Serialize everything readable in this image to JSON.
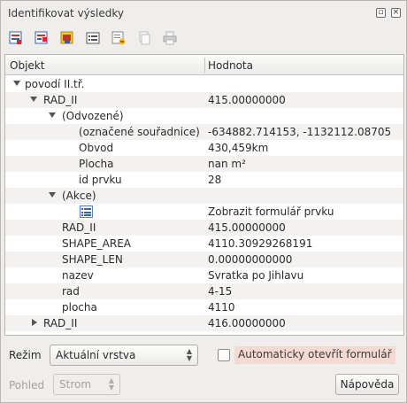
{
  "window": {
    "title": "Identifikovat výsledky"
  },
  "toolbar": {
    "buttons": [
      "expand-tree-icon",
      "collapse-tree-icon",
      "expand-new-features-icon",
      "open-form-icon",
      "clear-results-icon",
      "copy-icon",
      "print-icon"
    ]
  },
  "tree": {
    "columns": [
      "Objekt",
      "Hodnota"
    ],
    "rows": [
      {
        "label": "povodí II.tř.",
        "value": ""
      },
      {
        "label": "RAD_II",
        "value": "415.00000000"
      },
      {
        "label": "(Odvozené)",
        "value": ""
      },
      {
        "label": "(označené souřadnice)",
        "value": "-634882.714153, -1132112.08705"
      },
      {
        "label": "Obvod",
        "value": "430,459km"
      },
      {
        "label": "Plocha",
        "value": "nan m²"
      },
      {
        "label": "id prvku",
        "value": "28"
      },
      {
        "label": "(Akce)",
        "value": ""
      },
      {
        "label": "",
        "value": "Zobrazit formulář prvku"
      },
      {
        "label": "RAD_II",
        "value": "415.00000000"
      },
      {
        "label": "SHAPE_AREA",
        "value": "4110.30929268191"
      },
      {
        "label": "SHAPE_LEN",
        "value": "0.00000000000"
      },
      {
        "label": "nazev",
        "value": "Svratka po Jihlavu"
      },
      {
        "label": "rad",
        "value": "4-15"
      },
      {
        "label": "plocha",
        "value": "4110"
      },
      {
        "label": "RAD_II",
        "value": "416.00000000"
      }
    ]
  },
  "footer": {
    "mode_label": "Režim",
    "mode_value": "Aktuální vrstva",
    "auto_open_label": "Automaticky otevřít formulář",
    "view_label": "Pohled",
    "view_value": "Strom",
    "help_label": "Nápověda"
  }
}
